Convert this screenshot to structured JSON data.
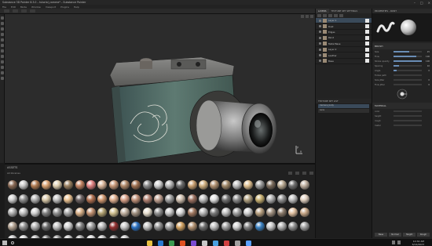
{
  "window": {
    "title": "Substance 3D Painter 8.3.0 – tutorial_camera* – Substance Painter"
  },
  "menubar": {
    "items": [
      "File",
      "Edit",
      "Mode",
      "Window",
      "Viewport",
      "Plugins",
      "Help"
    ]
  },
  "viewport": {
    "axis_x": "x",
    "axis_y": "y"
  },
  "assets": {
    "title": "ASSETS",
    "filter": "All libraries",
    "grid_colors": [
      "#8a6a55",
      "#c8c8c8",
      "#b07a50",
      "#d8a070",
      "#e0d0b0",
      "#9a8060",
      "#c08060",
      "#e08080",
      "#d9b59a",
      "#c89878",
      "#b08868",
      "#a07050",
      "#8a8a8a",
      "#d0d0d0",
      "#b5b5b5",
      "#6a6a6a",
      "#c9a070",
      "#d0b080",
      "#b09070",
      "#a08868",
      "#c0c0c0",
      "#e0c090",
      "#9a9a9a",
      "#7a6a5a",
      "#b8a890",
      "#707070",
      "#c0b0a0",
      "#d0d0d0",
      "#8c8c8c",
      "#b0b0b0",
      "#d8c8a8",
      "#c0c0c0",
      "#e8c090",
      "#6a6060",
      "#b07050",
      "#d09870",
      "#e0b090",
      "#d8a088",
      "#c09078",
      "#b08070",
      "#c0a090",
      "#a0a0a0",
      "#d0c0b0",
      "#9a7060",
      "#c0c0c0",
      "#e0e0e0",
      "#707070",
      "#8a8a8a",
      "#b0a080",
      "#c8b070",
      "#b0b0b0",
      "#909090",
      "#c0c0c0",
      "#e0d0c0",
      "#b0b0b0",
      "#c0c0c0",
      "#d0d0d0",
      "#808080",
      "#909090",
      "#a8a8a8",
      "#d8b088",
      "#c09070",
      "#b0a070",
      "#d0c090",
      "#c0b0a0",
      "#a09080",
      "#e8e0d0",
      "#909090",
      "#c8c8c8",
      "#d8d8d8",
      "#a07860",
      "#b8b8b8",
      "#7a7a7a",
      "#c0c0c0",
      "#a0a0a0",
      "#d0d0d0",
      "#b8a080",
      "#a09080",
      "#8a7a6a",
      "#e0c0a0",
      "#c8a888",
      "#b0a090",
      "#909090",
      "#b0b0b0",
      "#6a6a6a",
      "#c0c0c0",
      "#d0d0d0",
      "#808080",
      "#a0a0a0",
      "#b8b8b8",
      "#903030",
      "#c8c8c8",
      "#2a70c0",
      "#c0c0c0",
      "#909090",
      "#a0a0a0",
      "#d0a060",
      "#b09070",
      "#707070",
      "#c0c0c0",
      "#a0a0a0",
      "#d0d0d0",
      "#808080",
      "#3a80c0",
      "#c8c8c8",
      "#b0b0b0",
      "#909090",
      "#a0a0a0",
      "#c0c0c0",
      "#d0d0d0",
      "#b0b0b0",
      "#707070",
      "#8a8a8a",
      "#c0c0c0",
      "#a0a0a0",
      "#d8d8d8",
      "#b8b8b8",
      "#909090",
      "#c0c0c0"
    ]
  },
  "layers": {
    "tab_layers": "LAYERS",
    "tab_texture_set": "TEXTURE SET SETTINGS",
    "rows": [
      {
        "name": "Layer 1"
      },
      {
        "name": "Dust"
      },
      {
        "name": "Edges"
      },
      {
        "name": "Paint"
      },
      {
        "name": "Metal Base"
      },
      {
        "name": "Layer 2"
      },
      {
        "name": "Leather"
      },
      {
        "name": "Base"
      }
    ]
  },
  "texture_set": {
    "header": "TEXTURE SET LIST",
    "items": [
      "Camera_body",
      "Lens"
    ]
  },
  "properties": {
    "tab_brush": "PROPERTIES - PAINT",
    "section_brush": "BRUSH",
    "section_material": "MATERIAL",
    "params": [
      {
        "label": "Size",
        "fill": 0.55,
        "value": "25"
      },
      {
        "label": "Flow",
        "fill": 0.8,
        "value": "100"
      },
      {
        "label": "Stroke opacity",
        "fill": 1.0,
        "value": "100"
      },
      {
        "label": "Spacing",
        "fill": 0.2,
        "value": "10"
      },
      {
        "label": "Angle",
        "fill": 0.1,
        "value": "0"
      },
      {
        "label": "Follow path",
        "fill": 0.0,
        "value": ""
      },
      {
        "label": "Size jitter",
        "fill": 0.0,
        "value": "0"
      },
      {
        "label": "Flow jitter",
        "fill": 0.0,
        "value": "0"
      }
    ],
    "material_params": [
      {
        "label": "color",
        "fill": 0.0,
        "value": ""
      },
      {
        "label": "height",
        "fill": 0.0,
        "value": ""
      },
      {
        "label": "rough",
        "fill": 0.0,
        "value": ""
      },
      {
        "label": "metal",
        "fill": 0.0,
        "value": ""
      }
    ],
    "footer": [
      "Base",
      "Normal",
      "Height",
      "Rough"
    ]
  },
  "taskbar": {
    "time": "10:32 AM",
    "date": "6/14/2023",
    "app_colors": [
      "#e8c040",
      "#2a7ad0",
      "#3a9a50",
      "#e05020",
      "#7a4ad0",
      "#c8c8c8",
      "#4aa0e0",
      "#d04040",
      "#a0a0a0",
      "#5aa0ff"
    ]
  }
}
